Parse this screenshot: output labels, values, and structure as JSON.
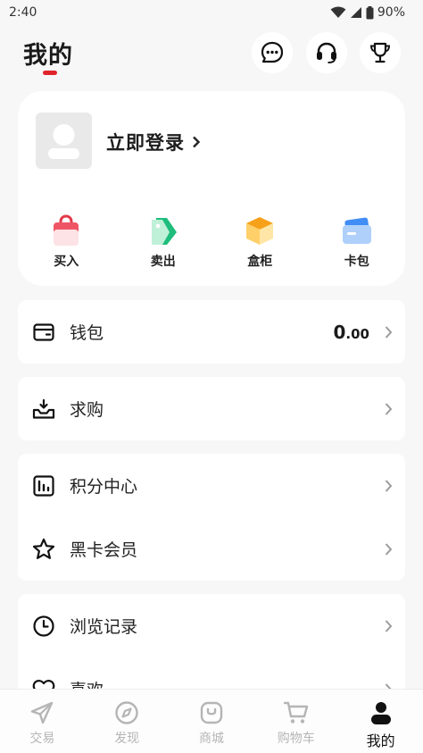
{
  "status_bar": {
    "time": "2:40",
    "battery": "90%"
  },
  "header": {
    "title": "我的"
  },
  "profile": {
    "login_label": "立即登录",
    "shortcuts": [
      {
        "label": "买入",
        "icon": "shopping-bag-icon"
      },
      {
        "label": "卖出",
        "icon": "tag-icon"
      },
      {
        "label": "盒柜",
        "icon": "box-icon"
      },
      {
        "label": "卡包",
        "icon": "card-wallet-icon"
      }
    ]
  },
  "menu": {
    "wallet": {
      "label": "钱包",
      "value_int": "0",
      "value_dec": ".00"
    },
    "wanted": {
      "label": "求购"
    },
    "points": {
      "label": "积分中心"
    },
    "black_card": {
      "label": "黑卡会员"
    },
    "history": {
      "label": "浏览记录"
    },
    "likes": {
      "label": "喜欢"
    }
  },
  "bottom_nav": {
    "items": [
      {
        "label": "交易",
        "icon": "paper-plane-icon"
      },
      {
        "label": "发现",
        "icon": "compass-icon"
      },
      {
        "label": "商城",
        "icon": "shop-bag-icon"
      },
      {
        "label": "购物车",
        "icon": "cart-icon"
      },
      {
        "label": "我的",
        "icon": "person-icon",
        "active": true
      }
    ]
  },
  "colors": {
    "accent": "#e0242c",
    "background": "#f7f7f7",
    "inactive": "#b5b5b5"
  }
}
